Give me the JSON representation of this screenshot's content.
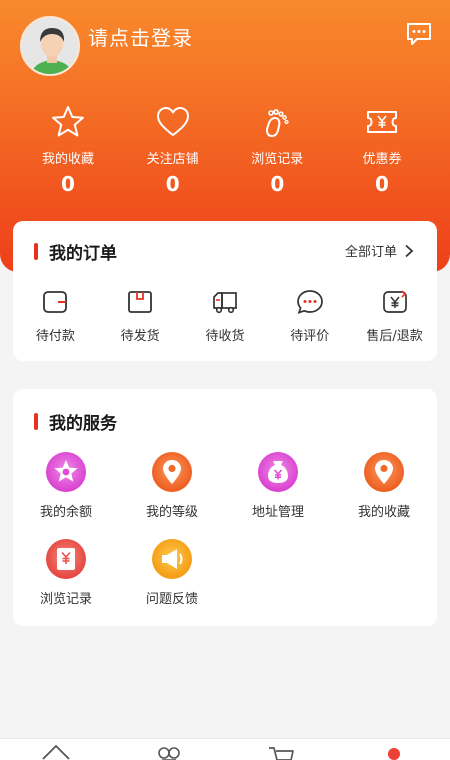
{
  "profile": {
    "login_prompt": "请点击登录",
    "avatar_icon": "user-avatar",
    "message_icon": "chat-bubble-icon"
  },
  "stats": [
    {
      "icon": "star-icon",
      "label": "我的收藏",
      "count": "0"
    },
    {
      "icon": "heart-icon",
      "label": "关注店铺",
      "count": "0"
    },
    {
      "icon": "footprint-icon",
      "label": "浏览记录",
      "count": "0"
    },
    {
      "icon": "coupon-icon",
      "label": "优惠券",
      "count": "0"
    }
  ],
  "orders": {
    "title": "我的订单",
    "all_link": "全部订单",
    "items": [
      {
        "icon": "wallet-icon",
        "label": "待付款"
      },
      {
        "icon": "package-icon",
        "label": "待发货"
      },
      {
        "icon": "truck-icon",
        "label": "待收货"
      },
      {
        "icon": "comment-icon",
        "label": "待评价"
      },
      {
        "icon": "refund-icon",
        "label": "售后/退款"
      }
    ]
  },
  "services": {
    "title": "我的服务",
    "items": [
      {
        "icon": "balance-icon",
        "label": "我的余额",
        "color": "#e04ad6"
      },
      {
        "icon": "level-icon",
        "label": "我的等级",
        "color": "#f26a2a"
      },
      {
        "icon": "address-icon",
        "label": "地址管理",
        "color": "#e04ad6"
      },
      {
        "icon": "favorites-icon",
        "label": "我的收藏",
        "color": "#f26a2a"
      },
      {
        "icon": "history-icon",
        "label": "浏览记录",
        "color": "#ea4a45"
      },
      {
        "icon": "feedback-icon",
        "label": "问题反馈",
        "color": "#f6a21c"
      }
    ]
  },
  "tabbar": [
    {
      "icon": "home-icon"
    },
    {
      "icon": "category-icon"
    },
    {
      "icon": "cart-icon"
    },
    {
      "icon": "profile-icon",
      "active": true
    }
  ],
  "colors": {
    "header_top": "#f98a2c",
    "header_bottom": "#ee3f1a",
    "accent": "#e8321f",
    "background": "#f4f4f4"
  }
}
